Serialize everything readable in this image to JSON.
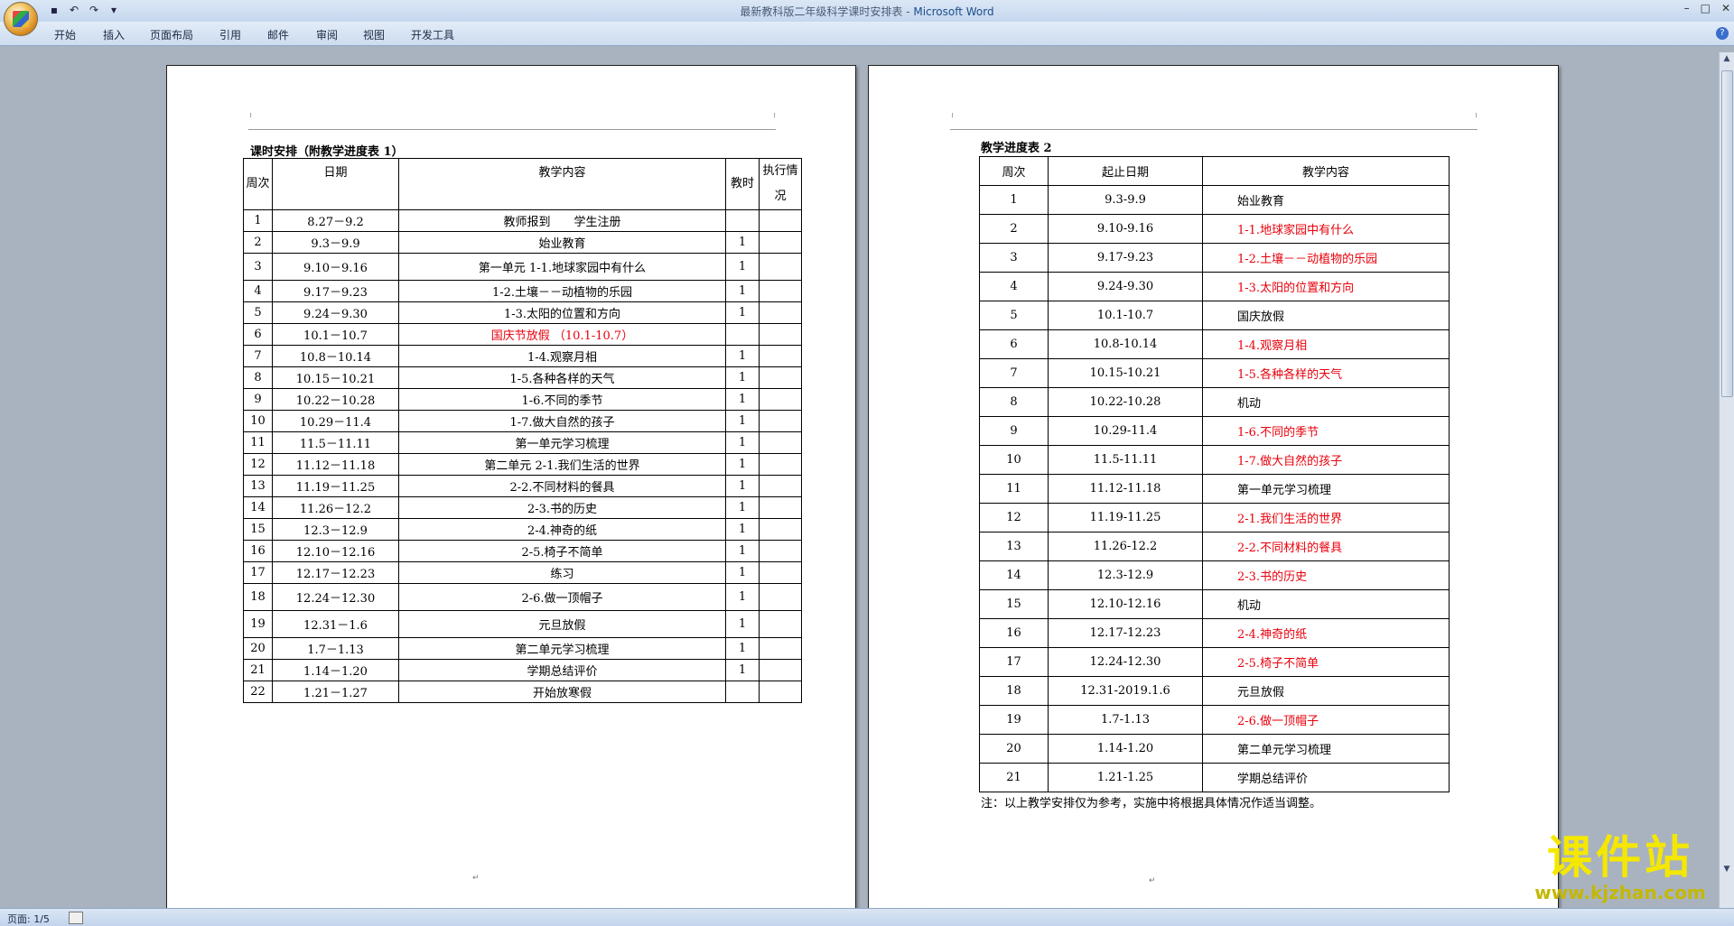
{
  "window": {
    "title_doc": "最新教科版二年级科学课时安排表",
    "title_sep": " - ",
    "title_app": "Microsoft Word"
  },
  "ribbon": {
    "tabs": [
      "开始",
      "插入",
      "页面布局",
      "引用",
      "邮件",
      "审阅",
      "视图",
      "开发工具"
    ]
  },
  "status": {
    "page": "页面: 1/5"
  },
  "page1": {
    "caption": "课时安排（附教学进度表 1）",
    "headers": {
      "week": "周次",
      "date": "日期",
      "content": "教学内容",
      "hours": "教时",
      "status": "执行情况"
    },
    "rows": [
      {
        "week": "1",
        "date": "8.27－9.2",
        "content": "教师报到　　学生注册",
        "hours": "",
        "red": false
      },
      {
        "week": "2",
        "date": "9.3－9.9",
        "content": "始业教育",
        "hours": "1",
        "red": false
      },
      {
        "week": "3",
        "date": "9.10－9.16",
        "content": "第一单元 1-1.地球家园中有什么",
        "hours": "1",
        "red": false
      },
      {
        "week": "4",
        "date": "9.17－9.23",
        "content": "1-2.土壤－－动植物的乐园",
        "hours": "1",
        "red": false
      },
      {
        "week": "5",
        "date": "9.24－9.30",
        "content": "1-3.太阳的位置和方向",
        "hours": "1",
        "red": false
      },
      {
        "week": "6",
        "date": "10.1－10.7",
        "content": "国庆节放假 （10.1-10.7）",
        "hours": "",
        "red": true
      },
      {
        "week": "7",
        "date": "10.8－10.14",
        "content": "1-4.观察月相",
        "hours": "1",
        "red": false
      },
      {
        "week": "8",
        "date": "10.15－10.21",
        "content": "1-5.各种各样的天气",
        "hours": "1",
        "red": false
      },
      {
        "week": "9",
        "date": "10.22－10.28",
        "content": "1-6.不同的季节",
        "hours": "1",
        "red": false
      },
      {
        "week": "10",
        "date": "10.29－11.4",
        "content": "1-7.做大自然的孩子",
        "hours": "1",
        "red": false
      },
      {
        "week": "11",
        "date": "11.5－11.11",
        "content": "第一单元学习梳理",
        "hours": "1",
        "red": false
      },
      {
        "week": "12",
        "date": "11.12－11.18",
        "content": "第二单元 2-1.我们生活的世界",
        "hours": "1",
        "red": false
      },
      {
        "week": "13",
        "date": "11.19－11.25",
        "content": "2-2.不同材料的餐具",
        "hours": "1",
        "red": false
      },
      {
        "week": "14",
        "date": "11.26－12.2",
        "content": "2-3.书的历史",
        "hours": "1",
        "red": false
      },
      {
        "week": "15",
        "date": "12.3－12.9",
        "content": "2-4.神奇的纸",
        "hours": "1",
        "red": false
      },
      {
        "week": "16",
        "date": "12.10－12.16",
        "content": "2-5.椅子不简单",
        "hours": "1",
        "red": false
      },
      {
        "week": "17",
        "date": "12.17－12.23",
        "content": "练习",
        "hours": "1",
        "red": false
      },
      {
        "week": "18",
        "date": "12.24－12.30",
        "content": "2-6.做一顶帽子",
        "hours": "1",
        "red": false
      },
      {
        "week": "19",
        "date": "12.31－1.6",
        "content": "元旦放假",
        "hours": "1",
        "red": false
      },
      {
        "week": "20",
        "date": "1.7－1.13",
        "content": "第二单元学习梳理",
        "hours": "1",
        "red": false
      },
      {
        "week": "21",
        "date": "1.14－1.20",
        "content": "学期总结评价",
        "hours": "1",
        "red": false
      },
      {
        "week": "22",
        "date": "1.21－1.27",
        "content": "开始放寒假",
        "hours": "",
        "red": false
      }
    ]
  },
  "page2": {
    "caption": "教学进度表 2",
    "headers": {
      "week": "周次",
      "date": "起止日期",
      "content": "教学内容"
    },
    "rows": [
      {
        "week": "1",
        "date": "9.3-9.9",
        "content": "始业教育",
        "red": false
      },
      {
        "week": "2",
        "date": "9.10-9.16",
        "content": "1-1.地球家园中有什么",
        "red": true
      },
      {
        "week": "3",
        "date": "9.17-9.23",
        "content": "1-2.土壤－－动植物的乐园",
        "red": true
      },
      {
        "week": "4",
        "date": "9.24-9.30",
        "content": "1-3.太阳的位置和方向",
        "red": true
      },
      {
        "week": "5",
        "date": "10.1-10.7",
        "content": "国庆放假",
        "red": false
      },
      {
        "week": "6",
        "date": "10.8-10.14",
        "content": "1-4.观察月相",
        "red": true
      },
      {
        "week": "7",
        "date": "10.15-10.21",
        "content": "1-5.各种各样的天气",
        "red": true
      },
      {
        "week": "8",
        "date": "10.22-10.28",
        "content": "机动",
        "red": false
      },
      {
        "week": "9",
        "date": "10.29-11.4",
        "content": "1-6.不同的季节",
        "red": true
      },
      {
        "week": "10",
        "date": "11.5-11.11",
        "content": "1-7.做大自然的孩子",
        "red": true
      },
      {
        "week": "11",
        "date": "11.12-11.18",
        "content": "第一单元学习梳理",
        "red": false
      },
      {
        "week": "12",
        "date": "11.19-11.25",
        "content": "2-1.我们生活的世界",
        "red": true
      },
      {
        "week": "13",
        "date": "11.26-12.2",
        "content": "2-2.不同材料的餐具",
        "red": true
      },
      {
        "week": "14",
        "date": "12.3-12.9",
        "content": "2-3.书的历史",
        "red": true
      },
      {
        "week": "15",
        "date": "12.10-12.16",
        "content": "机动",
        "red": false
      },
      {
        "week": "16",
        "date": "12.17-12.23",
        "content": "2-4.神奇的纸",
        "red": true
      },
      {
        "week": "17",
        "date": "12.24-12.30",
        "content": "2-5.椅子不简单",
        "red": true
      },
      {
        "week": "18",
        "date": "12.31-2019.1.6",
        "content": "元旦放假",
        "red": false
      },
      {
        "week": "19",
        "date": "1.7-1.13",
        "content": "2-6.做一顶帽子",
        "red": true
      },
      {
        "week": "20",
        "date": "1.14-1.20",
        "content": "第二单元学习梳理",
        "red": false
      },
      {
        "week": "21",
        "date": "1.21-1.25",
        "content": "学期总结评价",
        "red": false
      }
    ],
    "note": "注：以上教学安排仅为参考，实施中将根据具体情况作适当调整。"
  },
  "watermark": {
    "text": "课件站",
    "url": "www.kjzhan.com"
  },
  "colors": {
    "red_text": "#e8000b",
    "watermark": "#f5e800"
  }
}
